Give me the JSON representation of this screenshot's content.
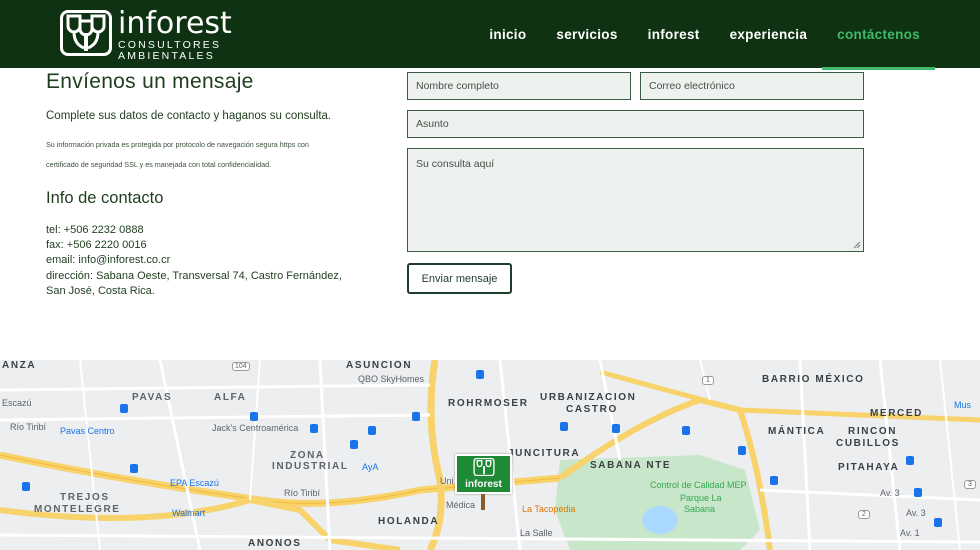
{
  "brand": {
    "name": "inforest",
    "subtitle_line1": "CONSULTORES",
    "subtitle_line2": "AMBIENTALES"
  },
  "nav": {
    "items": [
      {
        "label": "inicio",
        "active": false
      },
      {
        "label": "servicios",
        "active": false
      },
      {
        "label": "inforest",
        "active": false
      },
      {
        "label": "experiencia",
        "active": false
      },
      {
        "label": "contáctenos",
        "active": true
      }
    ]
  },
  "colors": {
    "header_bg": "#0f3212",
    "accent": "#3fba6a",
    "text": "#1f3d1f",
    "field_bg": "#eef2ef"
  },
  "contact": {
    "title": "Envíenos un mensaje",
    "lead": "Complete sus datos de contacto y haganos su consulta.",
    "privacy_line1": "Su información privada es protegida por protocolo de navegación segura https con",
    "privacy_line2": "certificado de seguridad SSL y es manejada con total confidencialidad.",
    "info_title": "Info de contacto",
    "tel": "tel: +506 2232 0888",
    "fax": "fax: +506 2220 0016",
    "email": "email: info@inforest.co.cr",
    "address_line1": "dirección: Sabana Oeste, Transversal 74, Castro Fernández,",
    "address_line2": "San José, Costa Rica."
  },
  "form": {
    "name_placeholder": "Nombre completo",
    "email_placeholder": "Correo electrónico",
    "subject_placeholder": "Asunto",
    "message_placeholder": "Su consulta aquí",
    "submit_label": "Enviar mensaje"
  },
  "map": {
    "pin_label": "inforest",
    "labels": {
      "anza": "ANZA",
      "asuncion": "ASUNCIÓN",
      "qbo": "QBO SkyHomes",
      "barrio_mexico": "BARRIO MÉXICO",
      "escazu": "Escazú",
      "pavas": "PAVAS",
      "alfa": "ALFA",
      "rohrmoser": "ROHRMOSER",
      "urbanizacion": "URBANIZACION",
      "castro": "CASTRO",
      "merced": "MERCED",
      "rio_tiribi": "Río Tiribí",
      "pavas_centro": "Pavas Centro",
      "jacks": "Jack's Centroamérica",
      "mantica": "MÁNTICA",
      "rincon": "RINCON",
      "cubillos": "CUBILLOS",
      "zona": "ZONA",
      "industrial": "INDUSTRIAL",
      "aya": "AyA",
      "juncitura": "JUNCITURA",
      "sabana_nte": "SABANA NTE",
      "pitahaya": "PITAHAYA",
      "epa": "EPA Escazú",
      "rio_tiribi2": "Río Tiribí",
      "control": "Control de Calidad MEP",
      "parque": "Parque La",
      "sabana": "Sabana",
      "trejos": "TREJOS",
      "montelegre": "MONTELEGRE",
      "walmart": "Walmart",
      "holanda": "HOLANDA",
      "la_tacopedia": "La Tacopedia",
      "la_salle": "La Salle",
      "anonos": "ANONOS",
      "medica": "Médica",
      "uni": "Uni",
      "av3": "Av. 3",
      "av3b": "Av. 3",
      "av1": "Av. 1",
      "mus": "Mus",
      "r104": "104",
      "r1": "1",
      "r2": "2",
      "r3": "3"
    }
  }
}
